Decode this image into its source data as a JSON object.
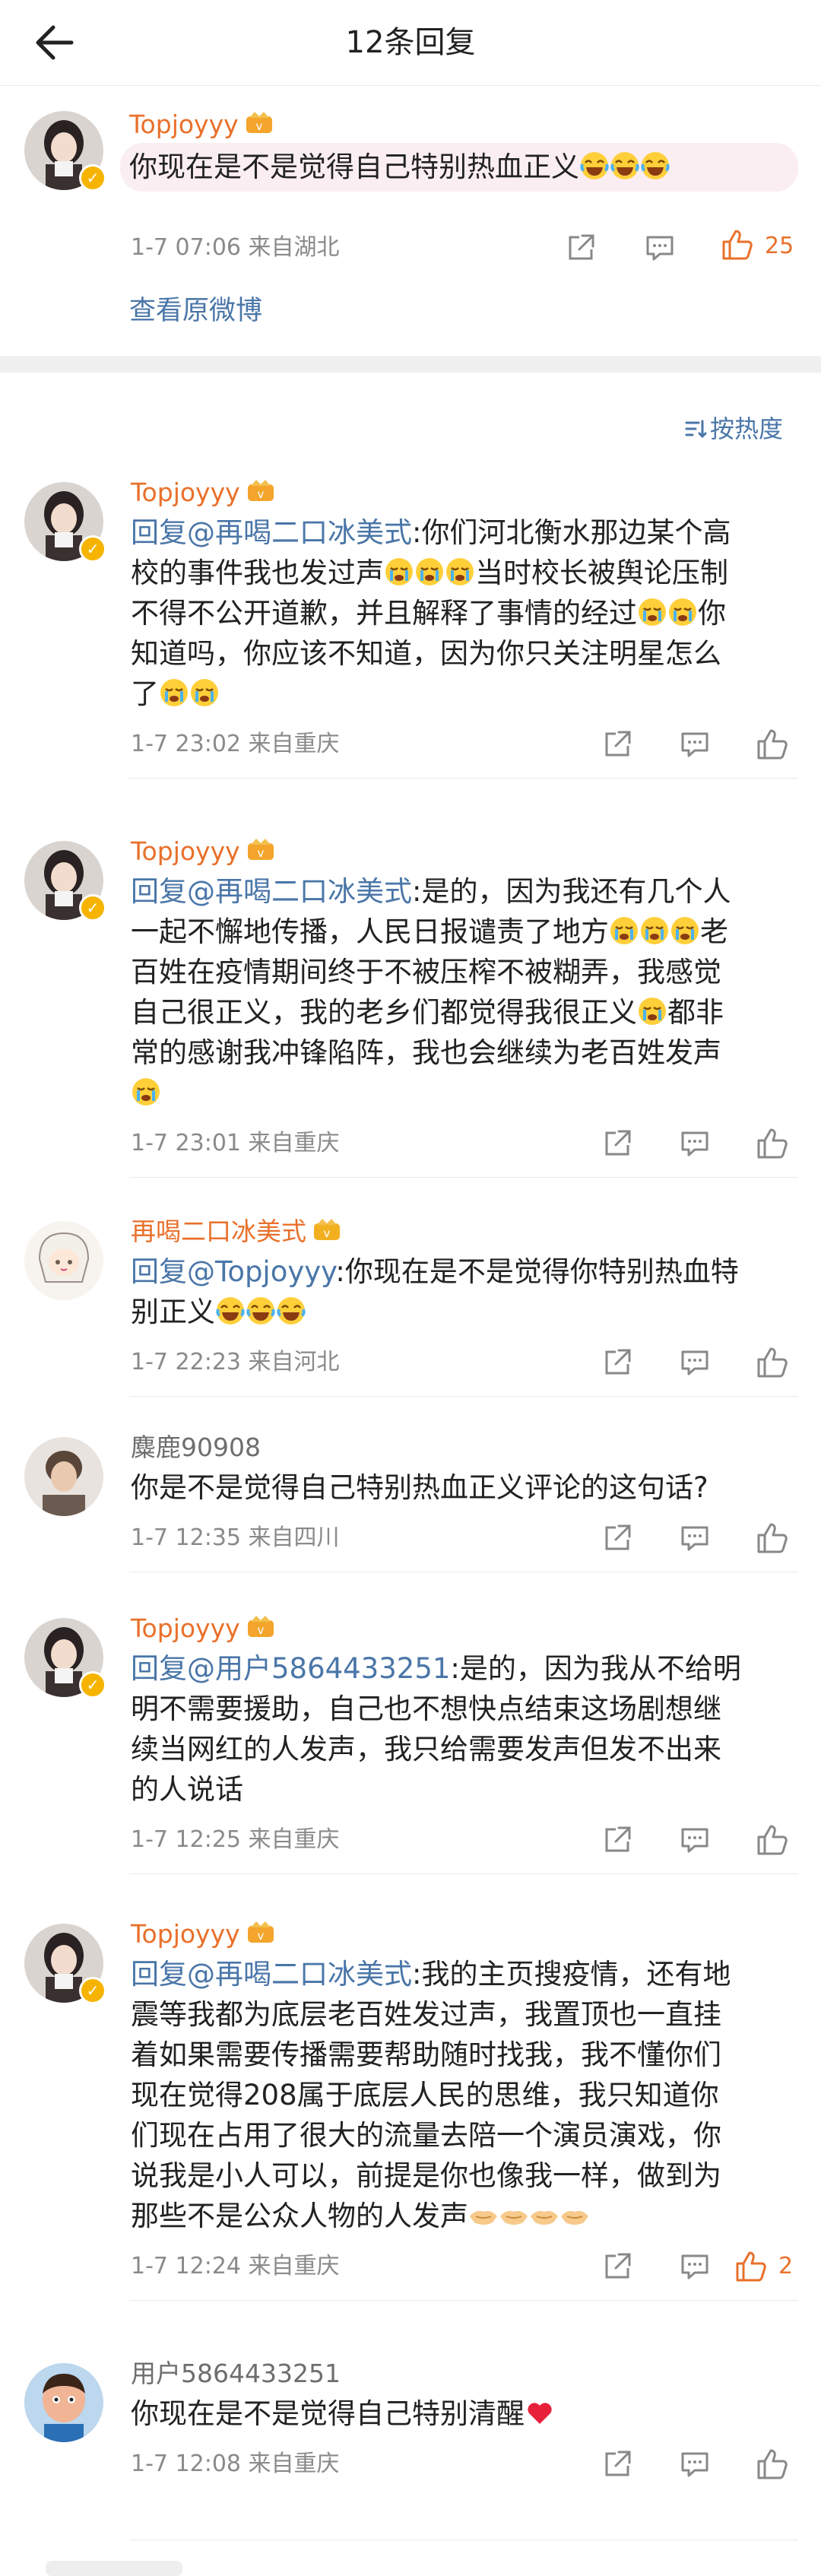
{
  "header": {
    "title": "12条回复"
  },
  "original": {
    "name": "Topjoyyy",
    "text": "你现在是不是觉得自己特别热血正义",
    "emoji_count": 3,
    "meta": "1-7 07:06  来自湖北",
    "likes": "25",
    "view_original": "查看原微博"
  },
  "sort_label": "按热度",
  "replies": [
    {
      "name": "Topjoyyy",
      "lines": [
        {
          "mention": "回复@再喝二口冰美式",
          "text": ":你们河北衡水那边某个高"
        },
        {
          "text": "校的事件我也发过声",
          "emoji": 3,
          "text2": "当时校长被舆论压制"
        },
        {
          "text": "不得不公开道歉，并且解释了事情的经过",
          "emoji": 2,
          "text2": "你"
        },
        {
          "text": "知道吗，你应该不知道，因为你只关注明星怎么"
        },
        {
          "text": "了",
          "emoji": 2
        }
      ],
      "meta": "1-7 23:02  来自重庆"
    },
    {
      "name": "Topjoyyy",
      "lines": [
        {
          "mention": "回复@再喝二口冰美式",
          "text": ":是的，因为我还有几个人"
        },
        {
          "text": "一起不懈地传播，人民日报谴责了地方",
          "emoji": 3,
          "text2": "老"
        },
        {
          "text": "百姓在疫情期间终于不被压榨不被糊弄，我感觉"
        },
        {
          "text": "自己很正义，我的老乡们都觉得我很正义",
          "emoji": 1,
          "text2": "都非"
        },
        {
          "text": "常的感谢我冲锋陷阵，我也会继续为老百姓发声"
        },
        {
          "text": "",
          "emoji": 1
        }
      ],
      "meta": "1-7 23:01  来自重庆"
    },
    {
      "name": "再喝二口冰美式",
      "lines": [
        {
          "mention": "回复@Topjoyyy",
          "text": ":你现在是不是觉得你特别热血特"
        },
        {
          "text": "别正义",
          "emoji": 3
        }
      ],
      "meta": "1-7 22:23  来自河北"
    },
    {
      "name": "麋鹿90908",
      "lines": [
        {
          "text": "你是不是觉得自己特别热血正义评论的这句话?"
        }
      ],
      "meta": "1-7 12:35  来自四川"
    },
    {
      "name": "Topjoyyy",
      "lines": [
        {
          "mention": "回复@用户5864433251",
          "text": ":是的，因为我从不给明"
        },
        {
          "text": "明不需要援助，自己也不想快点结束这场剧想继"
        },
        {
          "text": "续当网红的人发声，我只给需要发声但发不出来"
        },
        {
          "text": "的人说话"
        }
      ],
      "meta": "1-7 12:25  来自重庆"
    },
    {
      "name": "Topjoyyy",
      "lines": [
        {
          "mention": "回复@再喝二口冰美式",
          "text": ":我的主页搜疫情，还有地"
        },
        {
          "text": "震等我都为底层老百姓发过声，我置顶也一直挂"
        },
        {
          "text": "着如果需要传播需要帮助随时找我，我不懂你们"
        },
        {
          "text": "现在觉得208属于底层人民的思维，我只知道你"
        },
        {
          "text": "们现在占用了很大的流量去陪一个演员演戏，你"
        },
        {
          "text": "说我是小人可以，前提是你也像我一样，做到为"
        },
        {
          "text": "那些不是公众人物的人发声",
          "emoji": 4
        }
      ],
      "meta": "1-7 12:24  来自重庆",
      "likes": "2"
    },
    {
      "name": "用户5864433251",
      "lines": [
        {
          "text": "你现在是不是觉得自己特别清醒",
          "emoji": 1
        }
      ],
      "meta": "1-7 12:08  来自重庆"
    }
  ],
  "icons": {
    "back": "back-arrow-icon",
    "share": "share-icon",
    "comment": "comment-icon",
    "like": "thumbs-up-icon",
    "sort": "sort-icon"
  }
}
